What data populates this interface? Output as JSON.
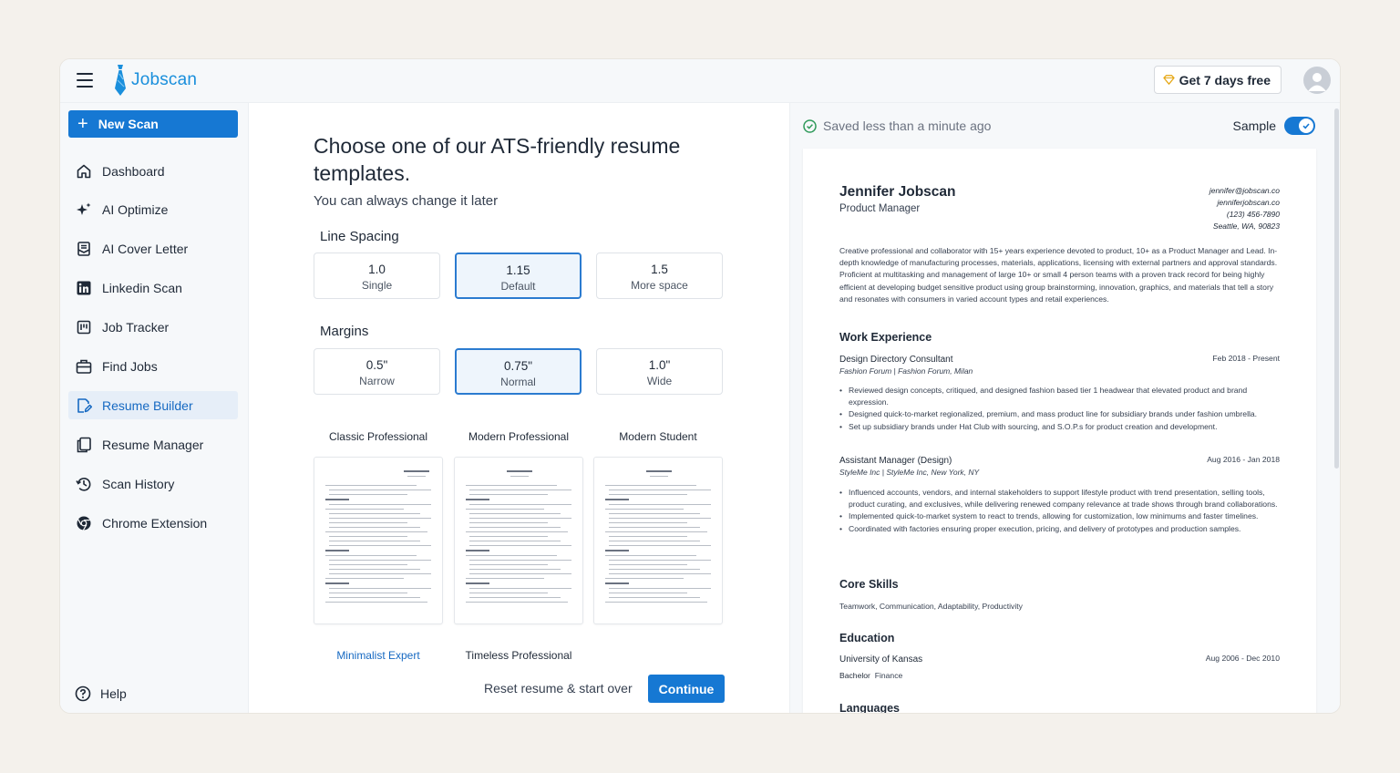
{
  "brand": {
    "name": "Jobscan",
    "color": "#1a8fdc"
  },
  "topbar": {
    "trial_button": "Get 7 days free"
  },
  "sidebar": {
    "new_scan": "New Scan",
    "items": [
      {
        "label": "Dashboard",
        "icon": "home-icon"
      },
      {
        "label": "AI Optimize",
        "icon": "sparkle-icon"
      },
      {
        "label": "AI Cover Letter",
        "icon": "letter-icon"
      },
      {
        "label": "Linkedin Scan",
        "icon": "linkedin-icon"
      },
      {
        "label": "Job Tracker",
        "icon": "tracker-icon"
      },
      {
        "label": "Find Jobs",
        "icon": "briefcase-icon"
      },
      {
        "label": "Resume Builder",
        "icon": "edit-document-icon",
        "active": true
      },
      {
        "label": "Resume Manager",
        "icon": "copy-icon"
      },
      {
        "label": "Scan History",
        "icon": "history-icon"
      },
      {
        "label": "Chrome Extension",
        "icon": "chrome-icon"
      }
    ],
    "help": "Help"
  },
  "main": {
    "title": "Choose one of our ATS-friendly resume templates.",
    "subtitle": "You can always change it later",
    "line_spacing": {
      "label": "Line Spacing",
      "options": [
        {
          "value": "1.0",
          "desc": "Single",
          "selected": false
        },
        {
          "value": "1.15",
          "desc": "Default",
          "selected": true
        },
        {
          "value": "1.5",
          "desc": "More space",
          "selected": false
        }
      ]
    },
    "margins": {
      "label": "Margins",
      "options": [
        {
          "value": "0.5\"",
          "desc": "Narrow",
          "selected": false
        },
        {
          "value": "0.75\"",
          "desc": "Normal",
          "selected": true
        },
        {
          "value": "1.0\"",
          "desc": "Wide",
          "selected": false
        }
      ]
    },
    "templates": [
      "Classic Professional",
      "Modern Professional",
      "Modern Student",
      "Minimalist Expert",
      "Timeless Professional"
    ],
    "thumb": {
      "name": "Jennifer Jobscan",
      "role": "Product Manager"
    },
    "reset": "Reset resume & start over",
    "continue": "Continue"
  },
  "preview": {
    "saved": "Saved less than a minute ago",
    "sample_label": "Sample",
    "sample_on": true,
    "resume": {
      "name": "Jennifer Jobscan",
      "role": "Product Manager",
      "contact": [
        "jennifer@jobscan.co",
        "jenniferjobscan.co",
        "(123) 456-7890",
        "Seattle, WA, 90823"
      ],
      "summary": "Creative professional and collaborator with 15+ years experience devoted to product, 10+ as a Product Manager and Lead. In-depth knowledge of manufacturing processes, materials, applications, licensing with external partners and approval standards. Proficient at multitasking and management of large 10+ or small 4 person teams with a proven track record for being highly efficient at developing budget sensitive product using group brainstorming, innovation, graphics, and materials that tell a story and resonates with consumers in varied account types and retail experiences.",
      "work_heading": "Work Experience",
      "jobs": [
        {
          "title": "Design Directory Consultant",
          "company": "Fashion Forum | Fashion Forum, Milan",
          "dates": "Feb 2018 - Present",
          "bullets": [
            "Reviewed design concepts, critiqued, and designed fashion based tier 1 headwear that elevated product and brand expression.",
            "Designed quick-to-market regionalized, premium, and mass product line for subsidiary brands under fashion umbrella.",
            "Set up subsidiary brands under Hat Club with sourcing, and S.O.P.s for product creation and development."
          ]
        },
        {
          "title": "Assistant Manager (Design)",
          "company": "StyleMe Inc | StyleMe Inc, New York, NY",
          "dates": "Aug 2016 - Jan 2018",
          "bullets": [
            "Influenced accounts, vendors, and internal stakeholders to support lifestyle product with trend presentation, selling tools, product curating, and exclusives, while delivering renewed company relevance at trade shows through brand collaborations.",
            "Implemented quick-to-market system to react to trends, allowing for customization, low minimums and faster timelines.",
            "Coordinated with factories ensuring proper execution, pricing, and delivery of prototypes and production samples."
          ]
        }
      ],
      "skills_heading": "Core Skills",
      "skills": "Teamwork, Communication, Adaptability, Productivity",
      "education_heading": "Education",
      "school": "University of Kansas",
      "degree": "Bachelor",
      "field": "Finance",
      "edu_dates": "Aug 2006 - Dec 2010",
      "languages_heading": "Languages"
    }
  }
}
